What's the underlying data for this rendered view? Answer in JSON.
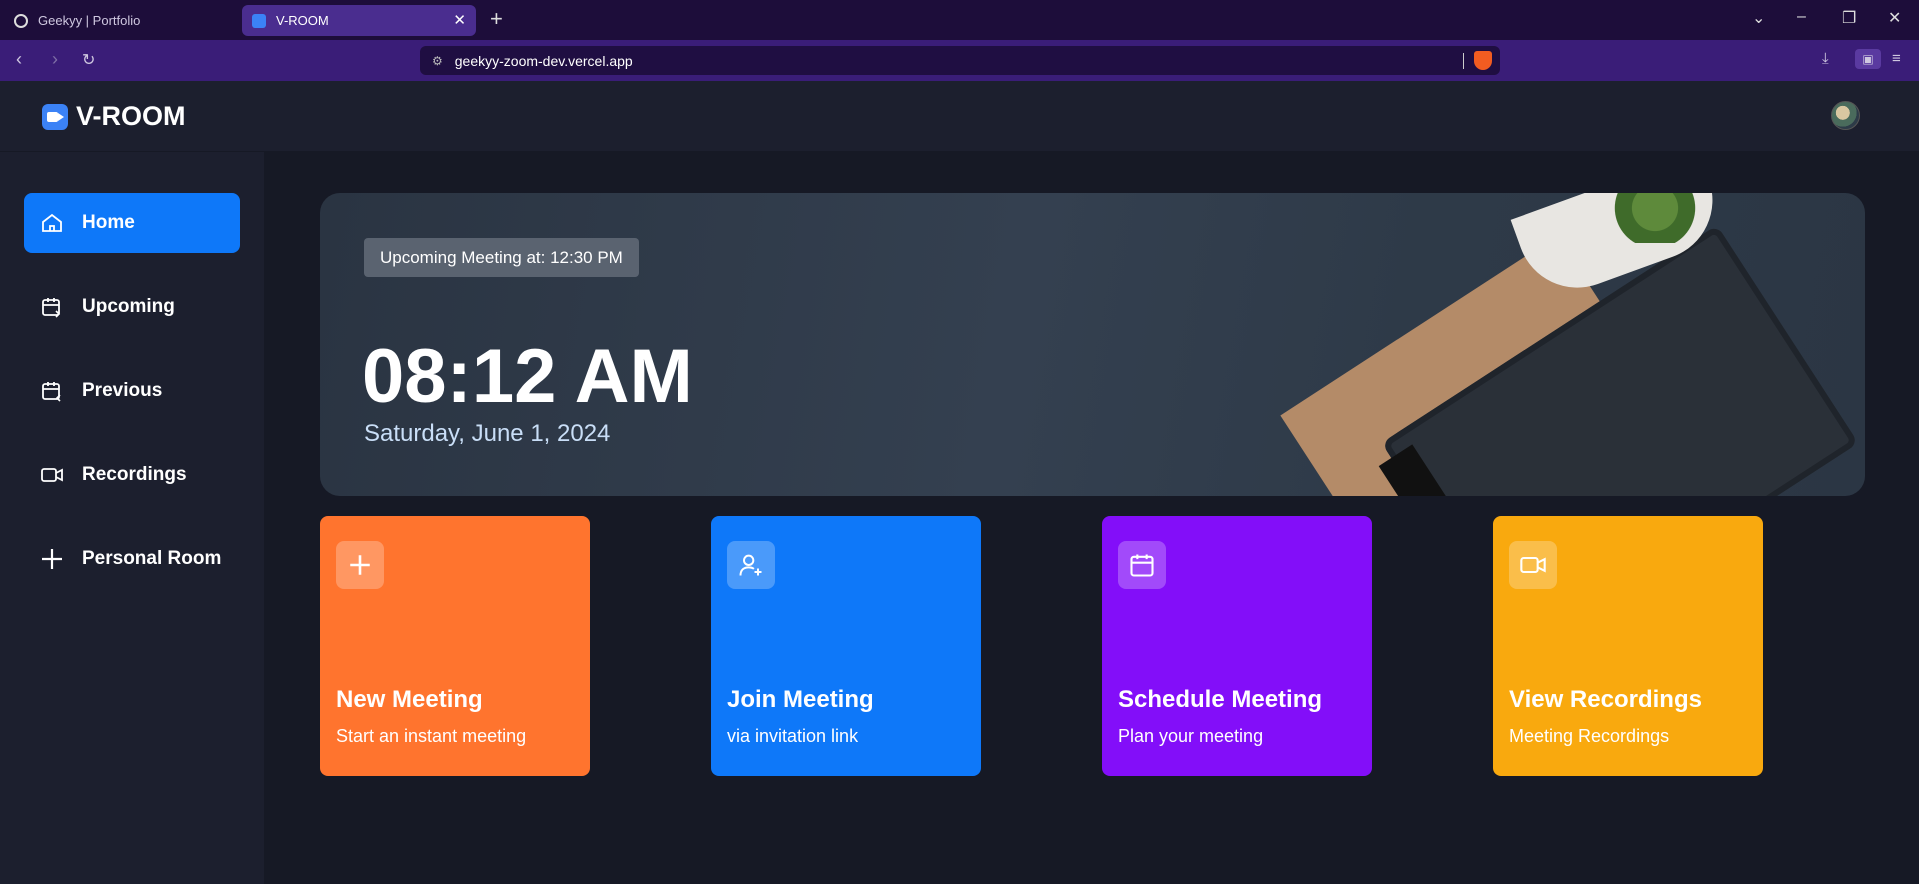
{
  "browser": {
    "tabs": [
      {
        "label": "Geekyy | Portfolio"
      },
      {
        "label": "V-ROOM"
      }
    ],
    "url": "geekyy-zoom-dev.vercel.app"
  },
  "app": {
    "name": "V-ROOM"
  },
  "sidebar": {
    "items": [
      {
        "label": "Home",
        "icon": "home-icon"
      },
      {
        "label": "Upcoming",
        "icon": "calendar-forward-icon"
      },
      {
        "label": "Previous",
        "icon": "calendar-back-icon"
      },
      {
        "label": "Recordings",
        "icon": "video-icon"
      },
      {
        "label": "Personal Room",
        "icon": "plus-icon"
      }
    ]
  },
  "hero": {
    "badge": "Upcoming Meeting at: 12:30 PM",
    "time": "08:12 AM",
    "date": "Saturday, June 1, 2024"
  },
  "cards": [
    {
      "title": "New Meeting",
      "subtitle": "Start an instant meeting",
      "icon": "plus-icon",
      "color": "#ff742e"
    },
    {
      "title": "Join Meeting",
      "subtitle": "via invitation link",
      "icon": "user-add-icon",
      "color": "#0e78f9"
    },
    {
      "title": "Schedule Meeting",
      "subtitle": "Plan your meeting",
      "icon": "calendar-icon",
      "color": "#830ef9"
    },
    {
      "title": "View Recordings",
      "subtitle": "Meeting Recordings",
      "icon": "video-icon",
      "color": "#f9a90e"
    }
  ]
}
